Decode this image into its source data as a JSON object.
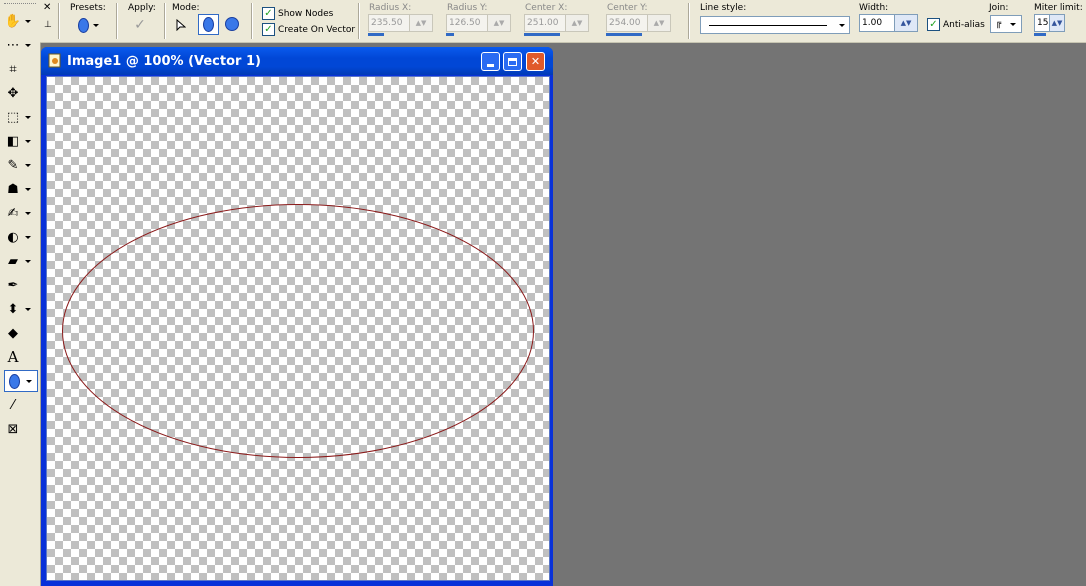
{
  "toolbox": {
    "close_glyph": "✕",
    "pin_glyph": "📌",
    "tools": [
      {
        "name": "pan-icon",
        "glyph": "✋",
        "dd": true
      },
      {
        "name": "zoom-icon",
        "glyph": "⋯",
        "dd": true
      },
      {
        "name": "crop-icon",
        "glyph": "⌗",
        "dd": false
      },
      {
        "name": "move-icon",
        "glyph": "✥",
        "dd": false
      },
      {
        "name": "selection-icon",
        "glyph": "⬚",
        "dd": true
      },
      {
        "name": "flood-fill-icon",
        "glyph": "◧",
        "dd": true
      },
      {
        "name": "paint-brush-icon",
        "glyph": "✎",
        "dd": true
      },
      {
        "name": "clone-brush-icon",
        "glyph": "☗",
        "dd": true
      },
      {
        "name": "color-replacer-icon",
        "glyph": "✍",
        "dd": true
      },
      {
        "name": "dodge-icon",
        "glyph": "◐",
        "dd": true
      },
      {
        "name": "eraser-icon",
        "glyph": "▰",
        "dd": true
      },
      {
        "name": "picture-tube-icon",
        "glyph": "✒",
        "dd": false
      },
      {
        "name": "airbrush-icon",
        "glyph": "⬍",
        "dd": true
      },
      {
        "name": "pen-icon",
        "glyph": "◆",
        "dd": false
      },
      {
        "name": "text-icon",
        "glyph": "A",
        "dd": false
      },
      {
        "name": "ellipse-tool-icon",
        "glyph": "⬭",
        "dd": true,
        "active": true
      },
      {
        "name": "eyedropper-icon",
        "glyph": "⁄",
        "dd": false
      },
      {
        "name": "object-selector-icon",
        "glyph": "⊠",
        "dd": false
      }
    ]
  },
  "options": {
    "presets_label": "Presets:",
    "apply_label": "Apply:",
    "mode_label": "Mode:",
    "show_nodes_label": "Show Nodes",
    "create_on_vector_label": "Create On Vector",
    "show_nodes_checked": true,
    "create_on_vector_checked": true,
    "radius_x_label": "Radius X:",
    "radius_x_value": "235.50",
    "radius_y_label": "Radius Y:",
    "radius_y_value": "126.50",
    "center_x_label": "Center X:",
    "center_x_value": "251.00",
    "center_y_label": "Center Y:",
    "center_y_value": "254.00",
    "line_style_label": "Line style:",
    "width_label": "Width:",
    "width_value": "1.00",
    "anti_alias_label": "Anti-alias",
    "anti_alias_checked": true,
    "join_label": "Join:",
    "miter_limit_label": "Miter limit:",
    "miter_limit_value": "15"
  },
  "window": {
    "title": "Image1 @ 100% (Vector 1)",
    "minimize_glyph": "_",
    "maximize_glyph": "□",
    "close_glyph": "✕"
  },
  "ellipse": {
    "center_x": 251.0,
    "center_y": 254.0,
    "radius_x": 235.5,
    "radius_y": 126.5,
    "stroke_color": "#8b1a1a"
  },
  "colors": {
    "accent": "#316ac5",
    "window_blue": "#0147d6",
    "workspace": "#747474",
    "checkbox_mark": "#21a121"
  }
}
